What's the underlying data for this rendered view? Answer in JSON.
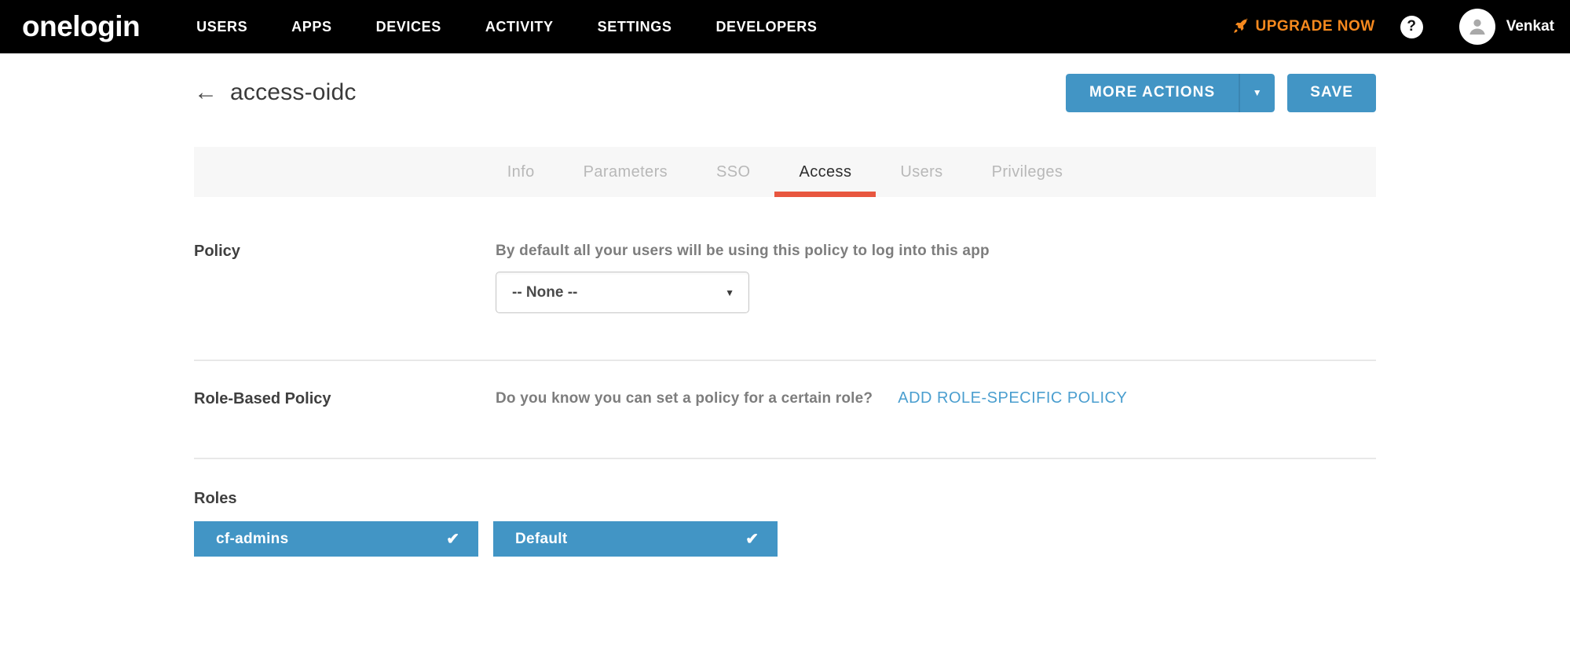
{
  "colors": {
    "nav_background": "#000000",
    "accent_blue": "#4295c5",
    "accent_orange": "#f6891e",
    "tab_active_underline": "#e8563f",
    "link_blue": "#4a9ecf",
    "tab_bar_background": "#f7f7f7"
  },
  "nav": {
    "logo": "onelogin",
    "items": [
      {
        "label": "USERS"
      },
      {
        "label": "APPS"
      },
      {
        "label": "DEVICES"
      },
      {
        "label": "ACTIVITY"
      },
      {
        "label": "SETTINGS"
      },
      {
        "label": "DEVELOPERS"
      }
    ],
    "upgrade": {
      "label": "UPGRADE NOW",
      "icon": "rocket-icon"
    },
    "help": {
      "glyph": "?",
      "icon": "question-icon"
    },
    "user": {
      "name": "Venkat",
      "icon": "avatar-person-icon"
    }
  },
  "header": {
    "back_glyph": "←",
    "title": "access-oidc",
    "more_actions": {
      "label": "MORE ACTIONS",
      "caret": "▼"
    },
    "save": {
      "label": "SAVE"
    }
  },
  "tabs": [
    {
      "label": "Info",
      "active": false
    },
    {
      "label": "Parameters",
      "active": false
    },
    {
      "label": "SSO",
      "active": false
    },
    {
      "label": "Access",
      "active": true
    },
    {
      "label": "Users",
      "active": false
    },
    {
      "label": "Privileges",
      "active": false
    }
  ],
  "sections": {
    "policy": {
      "label": "Policy",
      "helper": "By default all your users will be using this policy to log into this app",
      "dropdown": {
        "value": "-- None --",
        "caret": "▼"
      }
    },
    "role_based_policy": {
      "label": "Role-Based Policy",
      "helper": "Do you know you can set a policy for a certain role?",
      "link": "ADD ROLE-SPECIFIC POLICY"
    },
    "roles": {
      "label": "Roles",
      "items": [
        {
          "name": "cf-admins",
          "check": "✔"
        },
        {
          "name": "Default",
          "check": "✔"
        }
      ]
    }
  }
}
